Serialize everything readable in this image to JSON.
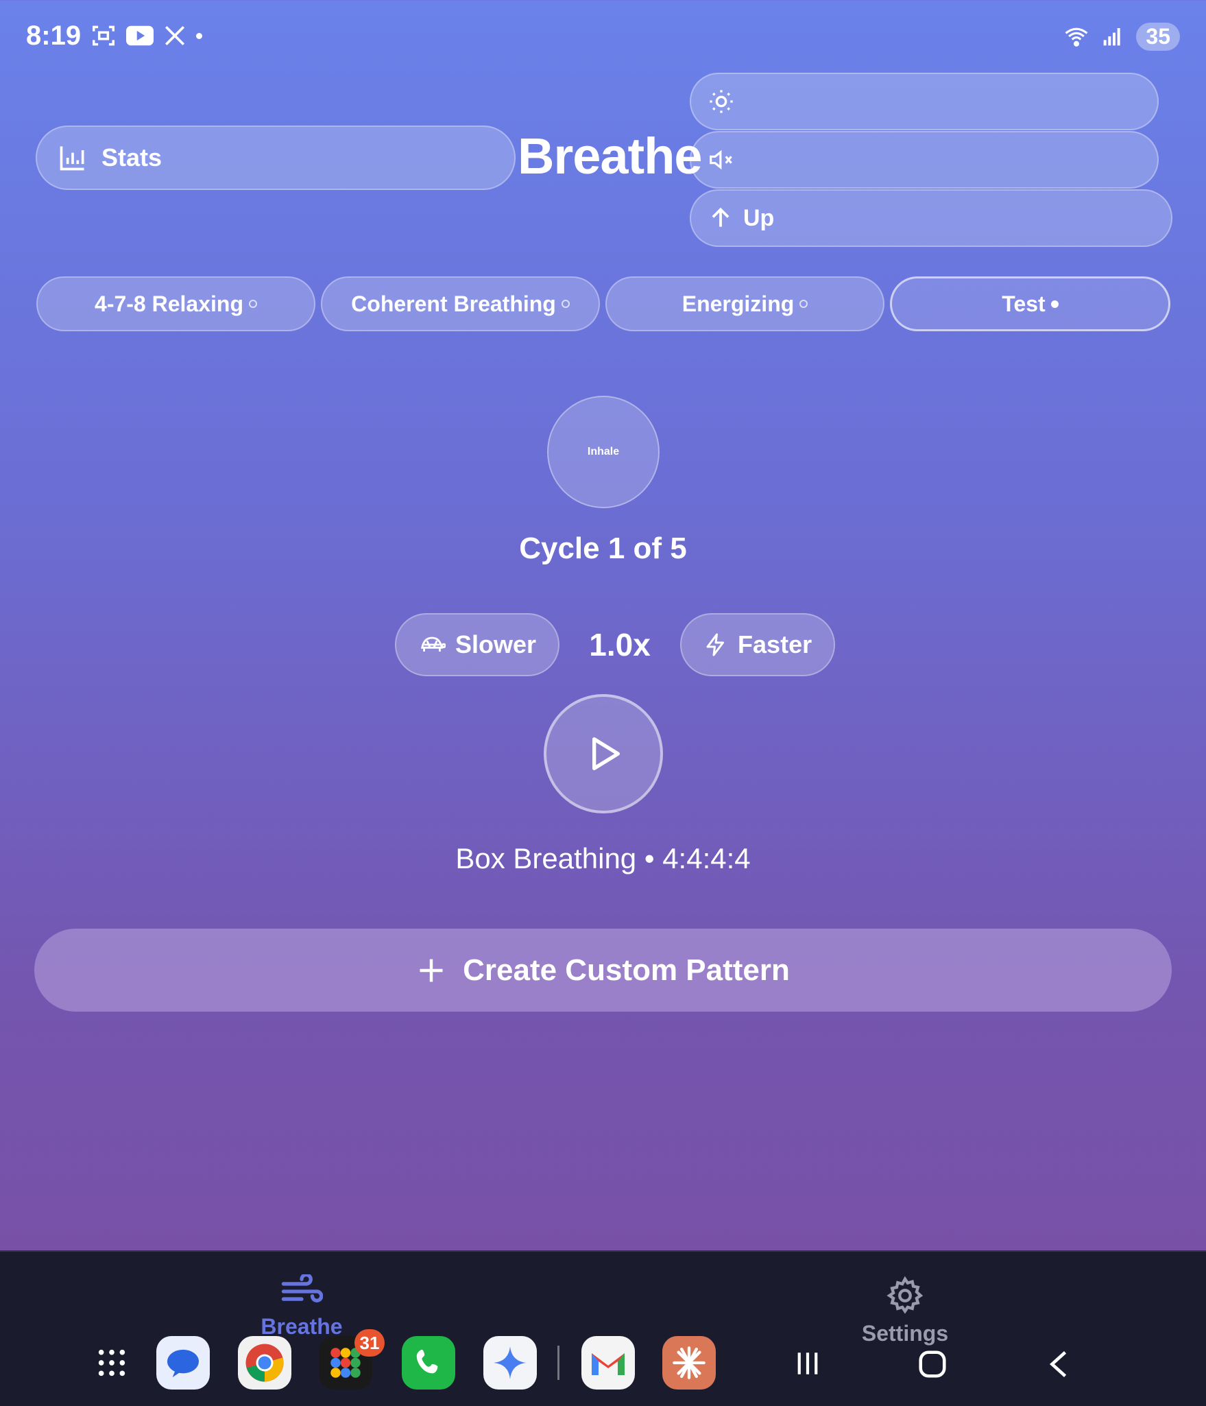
{
  "status_bar": {
    "time": "8:19",
    "battery": "35"
  },
  "header": {
    "stats_label": "Stats",
    "title": "Breathe",
    "theme_label": "",
    "sound_label": "",
    "up_label": "Up"
  },
  "patterns": [
    {
      "label": "4-7-8 Relaxing",
      "active": false
    },
    {
      "label": "Coherent Breathing",
      "active": false
    },
    {
      "label": "Energizing",
      "active": false
    },
    {
      "label": "Test",
      "active": true
    }
  ],
  "session": {
    "phase": "Inhale",
    "cycle_text": "Cycle 1 of 5",
    "slower_label": "Slower",
    "speed": "1.0x",
    "faster_label": "Faster",
    "pattern_info": "Box Breathing • 4:4:4:4"
  },
  "create_label": "Create Custom Pattern",
  "bottom_nav": {
    "breathe_label": "Breathe",
    "settings_label": "Settings"
  },
  "dock": {
    "badge_count": "31"
  },
  "colors": {
    "accent": "#6674e0",
    "nav_bg": "#1b1b2e"
  }
}
